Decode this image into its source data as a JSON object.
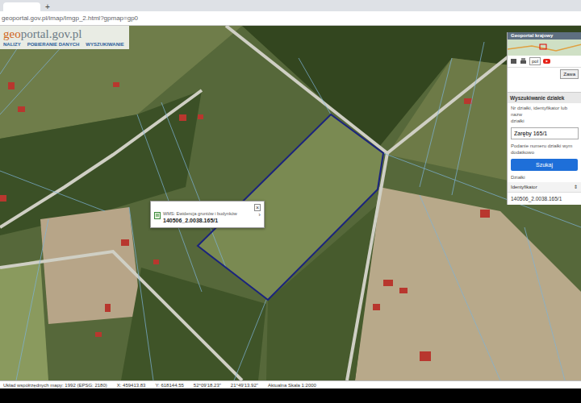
{
  "browser": {
    "new_tab": "+",
    "address": "geoportal.gov.pl/imap/Imgp_2.html?gpmap=gp0"
  },
  "app": {
    "logo_prefix": "geo",
    "logo_rest": "portal.gov.pl",
    "menu": [
      {
        "label": "NALIZY"
      },
      {
        "label": "POBIERANIE DANYCH"
      },
      {
        "label": "WYSZUKIWANIE"
      }
    ]
  },
  "minimap": {
    "title": "Geoportal krajowy"
  },
  "toolbar": {
    "language": "pol",
    "button": "Zawa"
  },
  "search_panel": {
    "title": "Wyszukiwanie działek",
    "hint": "Nr działki, identyfikator lub nazw",
    "hint2": "działki",
    "value": "Zaręby 165/1",
    "note": "Podanie numeru działki wym",
    "note2": "dodatkowo",
    "button": "Szukaj",
    "results_label": "Działki",
    "column": "Identyfikator",
    "sort": "⇕",
    "results": [
      "140506_2.0038.165/1"
    ]
  },
  "popup": {
    "title": "WMS: Ewidencja gruntów i budynków",
    "value": "140506_2.0038.165/1",
    "close": "×",
    "next": "›"
  },
  "status_bar": {
    "crs": "Układ współrzędnych mapy: 1992 (EPSG: 2180)",
    "x": "X: 459413.83",
    "y": "Y: 618144.55",
    "lat": "52°09'18.23\"",
    "lon": "21°49'13.92\"",
    "scale": "Aktualna Skala 1:2000"
  }
}
